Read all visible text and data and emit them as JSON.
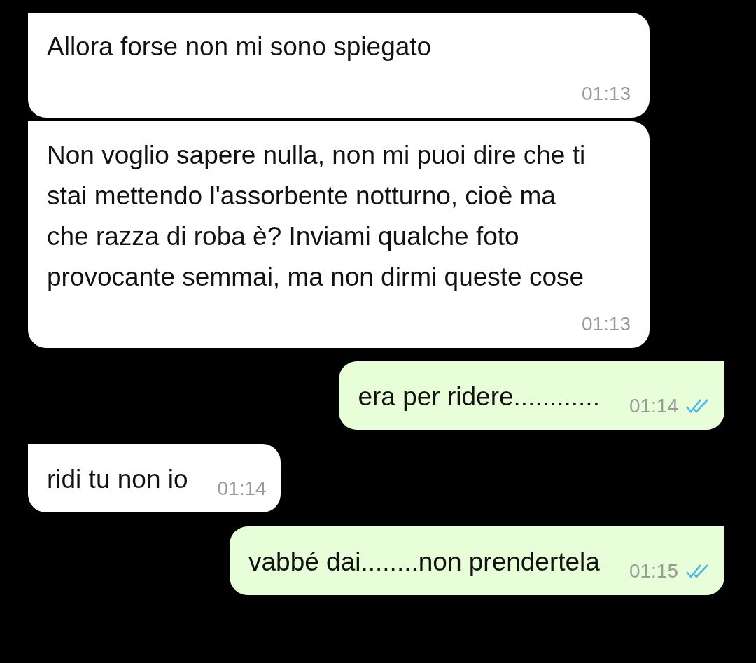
{
  "messages": [
    {
      "kind": "received",
      "time_below": true,
      "text": "Allora forse non mi sono spiegato",
      "time": "01:13"
    },
    {
      "kind": "received",
      "time_below": true,
      "text": "Non voglio sapere nulla, non mi puoi dire che ti stai mettendo l'assorbente notturno, cioè ma che razza di roba è? Inviami qualche foto provocante semmai, ma non dirmi queste cose",
      "time": "01:13"
    },
    {
      "kind": "sent",
      "time_below": false,
      "text": "era per ridere............",
      "time": "01:14",
      "read": true
    },
    {
      "kind": "received",
      "time_below": false,
      "text": "ridi tu non io",
      "time": "01:14"
    },
    {
      "kind": "sent",
      "time_below": false,
      "text": "vabbé dai........non prendertela",
      "time": "01:15",
      "read": true
    }
  ]
}
